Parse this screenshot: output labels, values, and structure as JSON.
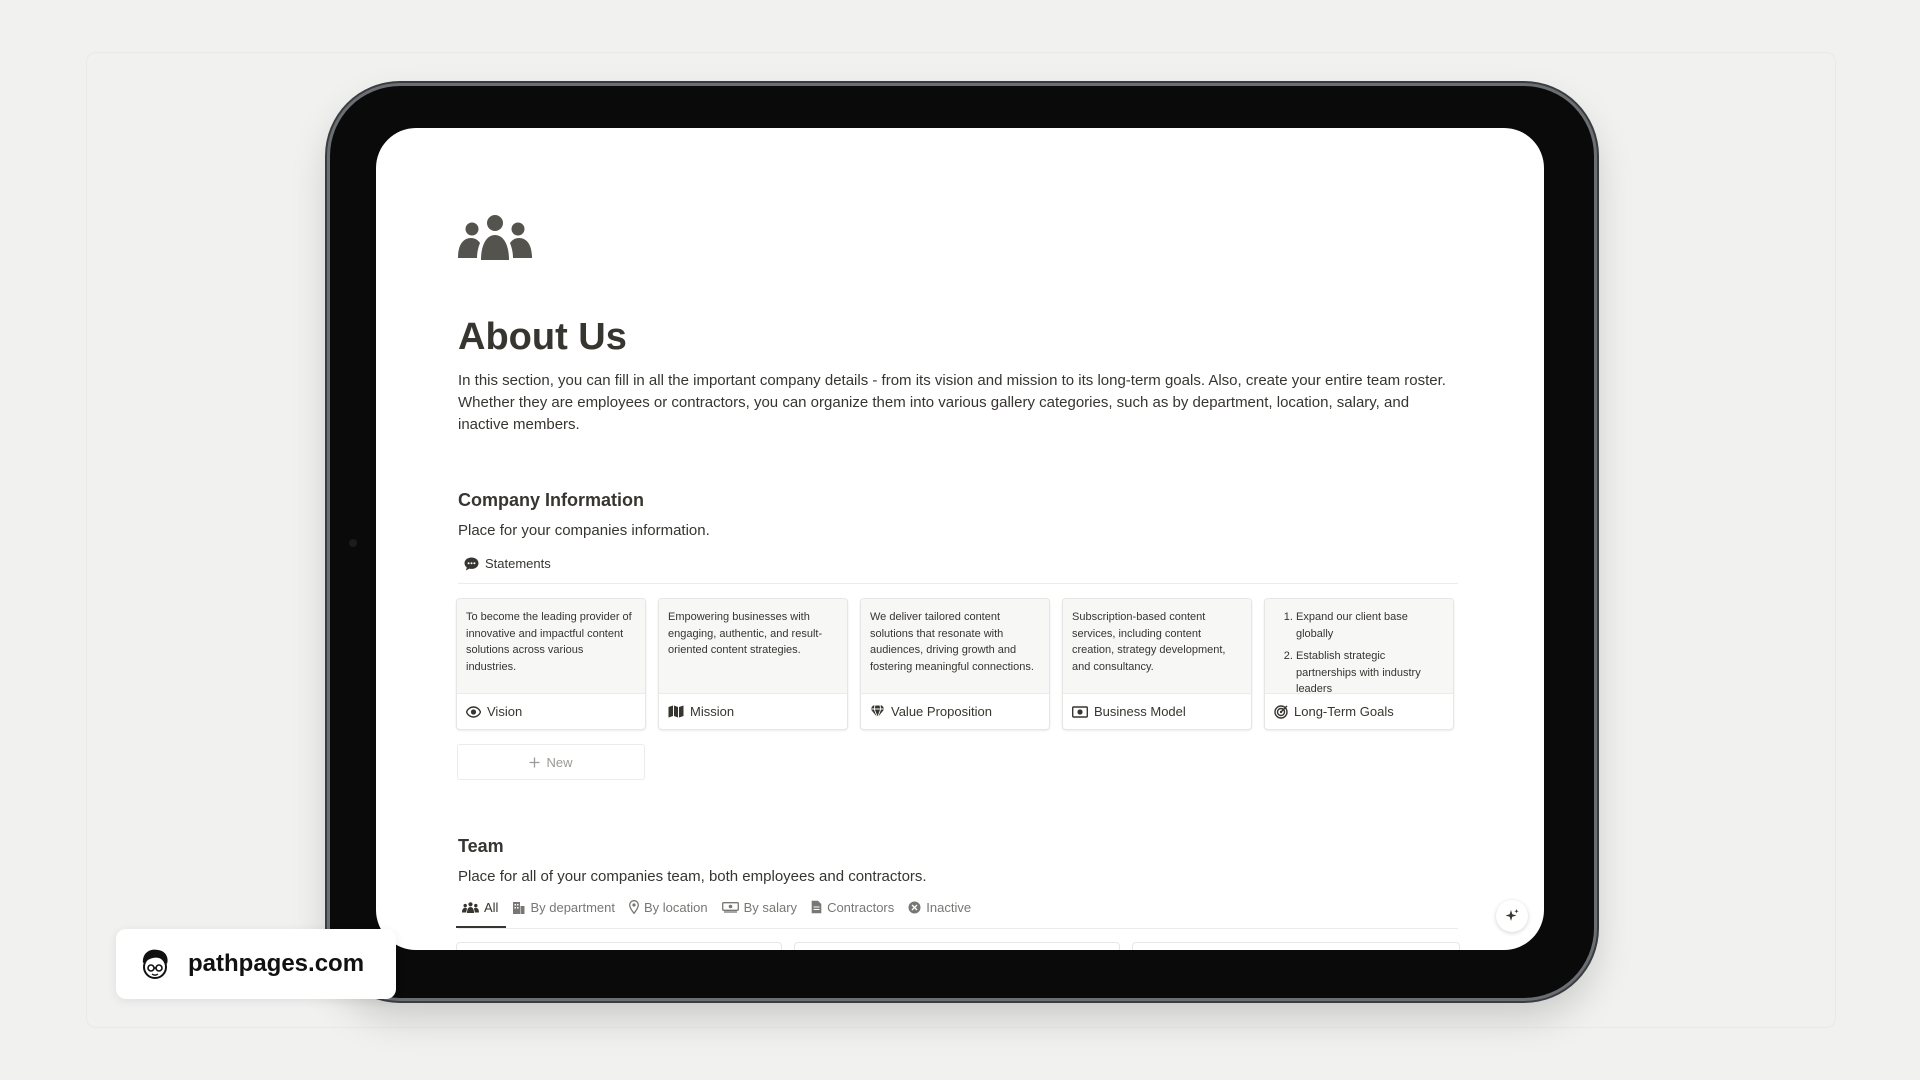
{
  "page": {
    "title": "About Us",
    "intro": "In this section, you can fill in all the important company details - from its vision and mission to its long-term goals. Also, create your entire team roster. Whether they are employees or contractors, you can organize them into various gallery categories, such as by department, location, salary, and inactive members."
  },
  "company": {
    "heading": "Company Information",
    "subtitle": "Place for your companies information.",
    "view_tab": "Statements",
    "cards": [
      {
        "title": "Vision",
        "icon": "eye-icon",
        "preview": "To become the leading provider of innovative and impactful content solutions across various industries."
      },
      {
        "title": "Mission",
        "icon": "map-icon",
        "preview": "Empowering businesses with engaging, authentic, and result-oriented content strategies."
      },
      {
        "title": "Value Proposition",
        "icon": "gem-icon",
        "preview": "We deliver tailored content solutions that resonate with audiences, driving growth and fostering meaningful connections."
      },
      {
        "title": "Business Model",
        "icon": "money-icon",
        "preview": " Subscription-based content services, including content creation, strategy development, and consultancy."
      },
      {
        "title": "Long-Term Goals",
        "icon": "target-icon",
        "preview_list": [
          "Expand our client base globally",
          "Establish strategic partnerships with industry leaders"
        ]
      }
    ],
    "new_label": "New"
  },
  "team": {
    "heading": "Team",
    "subtitle": "Place for all of your companies team, both employees and contractors.",
    "tabs": [
      "All",
      "By department",
      "By location",
      "By salary",
      "Contractors",
      "Inactive"
    ],
    "active_tab": "All"
  },
  "badge": {
    "text": "pathpages.com"
  },
  "colors": {
    "text": "#37352f",
    "muted": "#787774",
    "background": "#f1f1f0"
  }
}
